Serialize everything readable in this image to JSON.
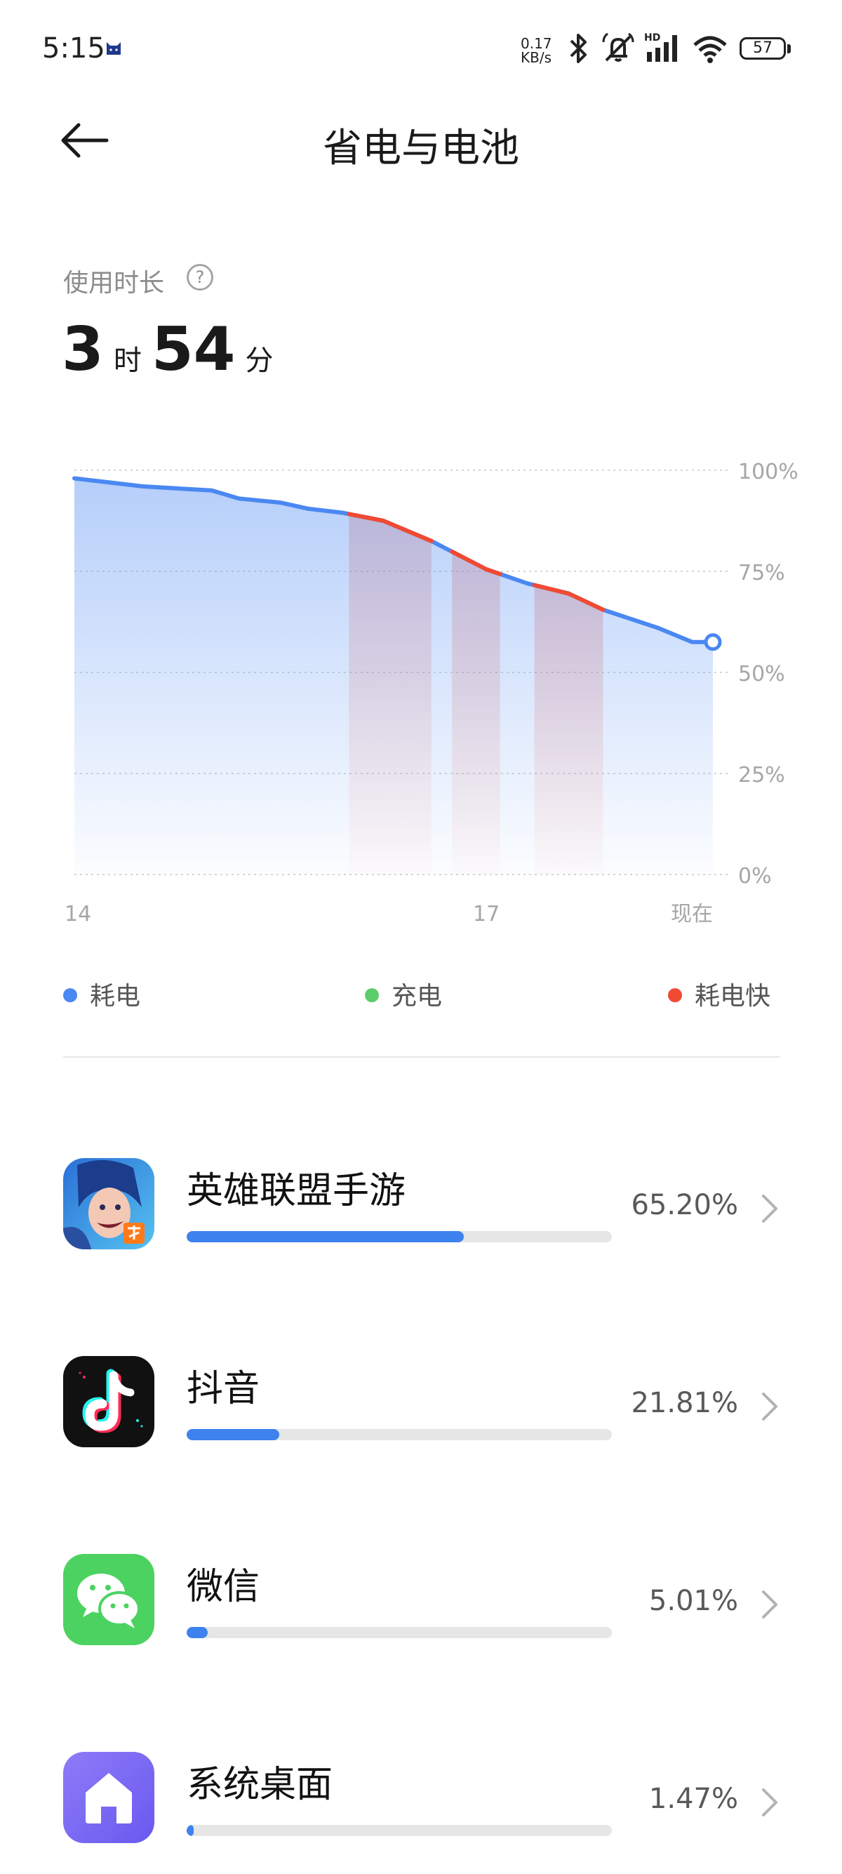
{
  "status_bar": {
    "time": "5:15",
    "speed_value": "0.17",
    "speed_unit": "KB/s",
    "network_badge": "HD",
    "battery": "57",
    "icons": [
      "cat-icon",
      "bluetooth-icon",
      "mute-icon",
      "signal-icon",
      "wifi-icon",
      "battery-icon"
    ]
  },
  "header": {
    "title": "省电与电池"
  },
  "usage": {
    "label": "使用时长",
    "hours": "3",
    "hours_unit": "时",
    "minutes": "54",
    "minutes_unit": "分"
  },
  "chart_data": {
    "type": "area",
    "x_ticks": [
      "14",
      "17",
      "现在"
    ],
    "y_ticks": [
      "100%",
      "75%",
      "50%",
      "25%",
      "0%"
    ],
    "ylim": [
      0,
      100
    ],
    "grid": true,
    "series": [
      {
        "name": "耗电",
        "color": "#4a88f2",
        "points": [
          [
            14.0,
            98
          ],
          [
            14.25,
            97
          ],
          [
            14.5,
            96
          ],
          [
            14.75,
            95.5
          ],
          [
            15.0,
            95
          ],
          [
            15.2,
            93
          ],
          [
            15.5,
            92
          ],
          [
            15.7,
            90.5
          ],
          [
            15.95,
            89.5
          ],
          [
            16.25,
            87.5
          ],
          [
            16.6,
            82.5
          ],
          [
            17.0,
            75.5
          ],
          [
            17.3,
            72
          ],
          [
            17.6,
            69.5
          ],
          [
            17.85,
            65.5
          ],
          [
            18.25,
            61
          ],
          [
            18.5,
            57.5
          ],
          [
            18.65,
            57.5
          ]
        ]
      }
    ],
    "fast_drain_ranges": [
      [
        16.0,
        16.6
      ],
      [
        16.75,
        17.1
      ],
      [
        17.35,
        17.85
      ]
    ]
  },
  "legend": {
    "drain": "耗电",
    "charge": "充电",
    "fast_drain": "耗电快",
    "drain_color": "#4a88f2",
    "charge_color": "#5dcc6b",
    "fast_drain_color": "#f04a32"
  },
  "apps": [
    {
      "name": "英雄联盟手游",
      "percent": "65.20%",
      "share": 0.652,
      "icon": "lol-icon"
    },
    {
      "name": "抖音",
      "percent": "21.81%",
      "share": 0.2181,
      "icon": "douyin-icon"
    },
    {
      "name": "微信",
      "percent": "5.01%",
      "share": 0.0501,
      "icon": "wechat-icon"
    },
    {
      "name": "系统桌面",
      "percent": "1.47%",
      "share": 0.0147,
      "icon": "home-icon"
    }
  ]
}
